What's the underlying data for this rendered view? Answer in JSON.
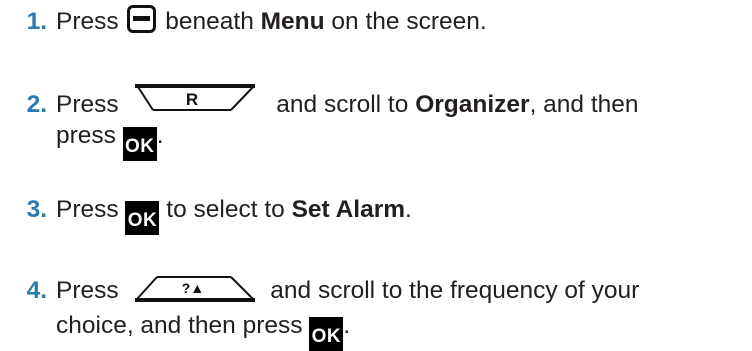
{
  "steps": [
    {
      "num": "1.",
      "pre": "Press",
      "key_menu": "menu-softkey",
      "post1": "beneath",
      "bold1": "Menu",
      "post2": "on the screen."
    },
    {
      "num": "2.",
      "pre": "Press",
      "key_label": "R",
      "post1": "and scroll to",
      "bold1": "Organizer",
      "post2": ", and then",
      "line2": "press",
      "ok": "OK",
      "end": "."
    },
    {
      "num": "3.",
      "pre": "Press",
      "ok": "OK",
      "post1": "to select to",
      "bold1": "Set Alarm",
      "end": "."
    },
    {
      "num": "4.",
      "pre": "Press",
      "key_label": "?▲",
      "post1": "and scroll to the frequency of your",
      "line2": "choice, and then press",
      "ok": "OK",
      "end": "."
    }
  ],
  "colors": {
    "number": "#2a7ab0",
    "text": "#231f20",
    "key": "#000000"
  }
}
